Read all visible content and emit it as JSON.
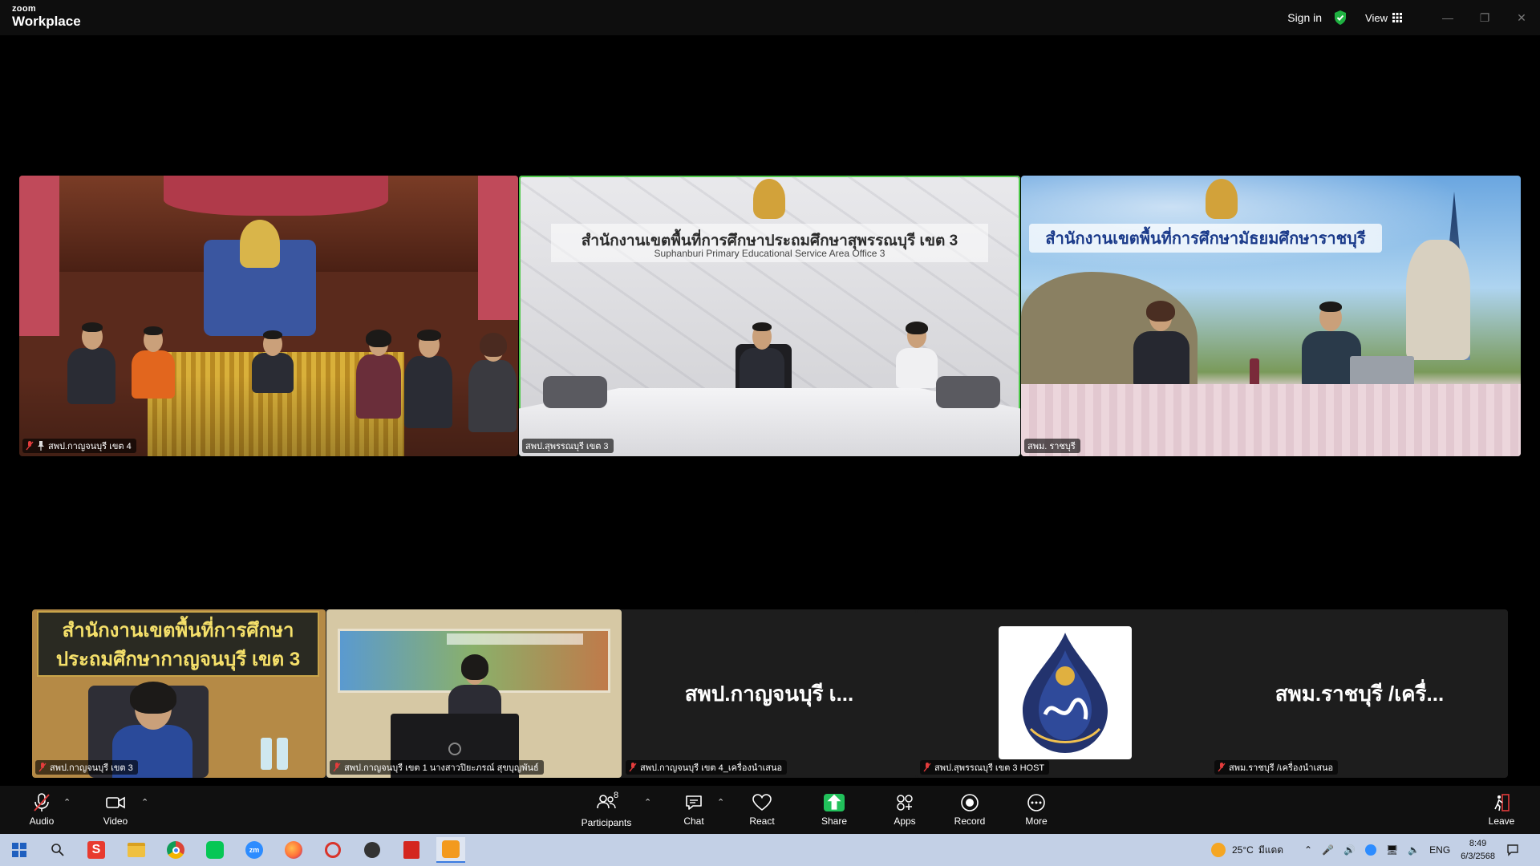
{
  "app": {
    "brand_small": "zoom",
    "brand_name": "Workplace",
    "sign_in": "Sign in",
    "view_label": "View"
  },
  "top_tiles": [
    {
      "name": "สพป.กาญจนบุรี เขต 4",
      "muted": true,
      "pinned": true,
      "speaking": false
    },
    {
      "name": "สพป.สุพรรณบุรี เขต 3",
      "muted": false,
      "pinned": false,
      "speaking": true,
      "banner_th": "สำนักงานเขตพื้นที่การศึกษาประถมศึกษาสุพรรณบุรี เขต 3",
      "banner_en": "Suphanburi Primary Educational Service Area Office 3"
    },
    {
      "name": "สพม. ราชบุรี",
      "muted": false,
      "pinned": false,
      "speaking": false,
      "banner_th": "สำนักงานเขตพื้นที่การศึกษามัธยมศึกษาราชบุรี"
    }
  ],
  "bottom_tiles": [
    {
      "name": "สพป.กาญจนบุรี เขต 3",
      "muted": true,
      "type": "video",
      "banner_th_1": "สำนักงานเขตพื้นที่การศึกษา",
      "banner_th_2": "ประถมศึกษากาญจนบุรี เขต 3"
    },
    {
      "name": "สพป.กาญจนบุรี เขต 1 นางสาวปิยะภรณ์ สุขบุญพันธ์",
      "muted": true,
      "type": "video"
    },
    {
      "name": "สพป.กาญจนบุรี เขต 4_เครื่องนำเสนอ",
      "muted": true,
      "type": "name",
      "display": "สพป.กาญจนบุรี เ..."
    },
    {
      "name": "สพป.สุพรรณบุรี เขต 3 HOST",
      "muted": true,
      "type": "logo"
    },
    {
      "name": "สพม.ราชบุรี /เครื่องนำเสนอ",
      "muted": true,
      "type": "name",
      "display": "สพม.ราชบุรี /เครื่..."
    }
  ],
  "toolbar": {
    "audio": "Audio",
    "video": "Video",
    "participants": "Participants",
    "participants_count": "8",
    "chat": "Chat",
    "react": "React",
    "share": "Share",
    "apps": "Apps",
    "record": "Record",
    "more": "More",
    "leave": "Leave"
  },
  "taskbar": {
    "weather_temp": "25°C",
    "weather_text": "มีแดด",
    "language": "ENG",
    "time": "8:49",
    "date": "6/3/2568"
  },
  "colors": {
    "speaking_border": "#4ec94a",
    "share_green": "#21c15b",
    "secure_green": "#1fb141"
  }
}
